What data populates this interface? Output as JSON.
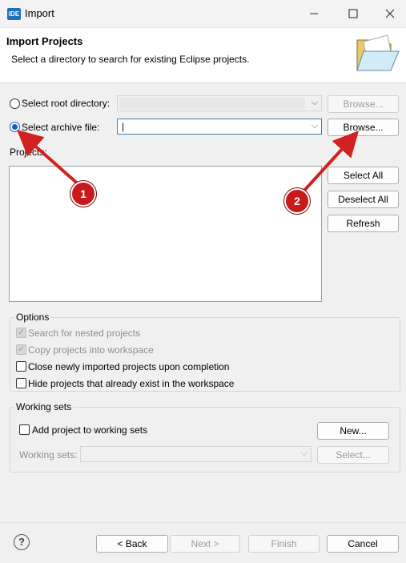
{
  "window": {
    "title": "Import",
    "app_icon": "IDE"
  },
  "header": {
    "title": "Import Projects",
    "description": "Select a directory to search for existing Eclipse projects."
  },
  "source": {
    "root_dir_label": "Select root directory:",
    "archive_label": "Select archive file:",
    "archive_value": "|",
    "browse_label": "Browse..."
  },
  "projects": {
    "label": "Projects:",
    "select_all": "Select All",
    "deselect_all": "Deselect All",
    "refresh": "Refresh"
  },
  "options": {
    "title": "Options",
    "search_nested": "Search for nested projects",
    "copy_projects": "Copy projects into workspace",
    "close_imported": "Close newly imported projects upon completion",
    "hide_existing": "Hide projects that already exist in the workspace"
  },
  "working_sets": {
    "title": "Working sets",
    "add_label": "Add project to working sets",
    "new_button": "New...",
    "sets_label": "Working sets:",
    "select_button": "Select..."
  },
  "footer": {
    "help": "?",
    "back": "< Back",
    "next": "Next >",
    "finish": "Finish",
    "cancel": "Cancel"
  },
  "annotations": {
    "marker1": "1",
    "marker2": "2",
    "color": "#d32020"
  }
}
